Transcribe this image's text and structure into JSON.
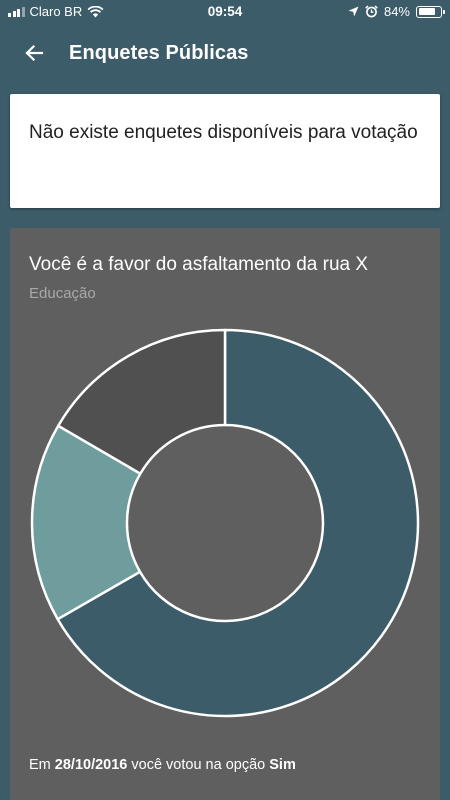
{
  "status_bar": {
    "carrier": "Claro BR",
    "time": "09:54",
    "battery": "84%",
    "battery_level": 0.84,
    "icons": [
      "signal-icon",
      "wifi-icon",
      "location-arrow-icon",
      "alarm-clock-icon",
      "battery-icon"
    ]
  },
  "app_bar": {
    "title": "Enquetes Públicas",
    "back_icon": "arrow-left-icon"
  },
  "notice": {
    "text": "Não existe enquetes disponíveis para votação"
  },
  "poll": {
    "question": "Você é a favor do asfaltamento da rua X",
    "category": "Educação",
    "vote_prefix": "Em",
    "vote_date": "28/10/2016",
    "vote_middle": "você votou na opção",
    "vote_option": "Sim"
  },
  "chart_data": {
    "type": "pie",
    "variant": "donut",
    "slices": [
      {
        "value": 66.7,
        "color": "#3c5c6a"
      },
      {
        "value": 16.7,
        "color": "#6f9c9d"
      },
      {
        "value": 16.6,
        "color": "#505050"
      }
    ],
    "title": "",
    "legend": "none"
  },
  "colors": {
    "background": "#3c5c6a",
    "card": "#ffffff",
    "poll_card": "#5f5f5f",
    "text_primary": "#212121",
    "text_secondary": "#a9a9a9"
  }
}
